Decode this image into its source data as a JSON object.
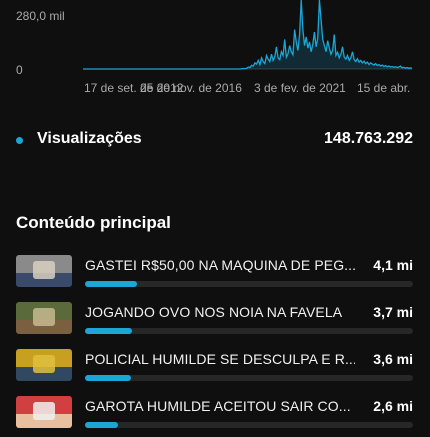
{
  "colors": {
    "accent": "#1ba6d6",
    "background": "#0f0f0f",
    "track": "#272727",
    "muted_text": "#aaaaaa"
  },
  "chart_data": {
    "type": "area",
    "title": "",
    "xlabel": "",
    "ylabel": "",
    "y_ticks": [
      "280,0 mil",
      "0"
    ],
    "x_ticks": [
      "17 de set. de 2012",
      "25 de nov. de 2016",
      "3 de fev. de 2021",
      "15 de abr."
    ],
    "ylim": [
      0,
      280000
    ],
    "series": [
      {
        "values": [
          0,
          0,
          0,
          0,
          0,
          0,
          0,
          0,
          0,
          0,
          0,
          0,
          0,
          0,
          0,
          0,
          0,
          0,
          0,
          0,
          0,
          0,
          0,
          0,
          0,
          0,
          0,
          0,
          0,
          0,
          0,
          0,
          0,
          0,
          0,
          0,
          0,
          0,
          0,
          0,
          0,
          0,
          0,
          0,
          0,
          0,
          0,
          0,
          0,
          0,
          0,
          0,
          0,
          0,
          0,
          0,
          0,
          0,
          0,
          0,
          0,
          0,
          0,
          0,
          0,
          0,
          0,
          0,
          0,
          0,
          0,
          0,
          0,
          0,
          0,
          0,
          0,
          0,
          0,
          0,
          0,
          0,
          0,
          0,
          0,
          0,
          0,
          0,
          0,
          0,
          0,
          0,
          0,
          0,
          0,
          0,
          1000,
          2000,
          1500,
          3000,
          8000,
          6000,
          15000,
          12000,
          25000,
          20000,
          35000,
          18000,
          45000,
          30000,
          22000,
          55000,
          40000,
          30000,
          60000,
          35000,
          50000,
          90000,
          45000,
          38000,
          70000,
          55000,
          120000,
          48000,
          62000,
          95000,
          70000,
          58000,
          160000,
          110000,
          75000,
          140000,
          280000,
          160000,
          95000,
          130000,
          85000,
          110000,
          70000,
          100000,
          150000,
          90000,
          125000,
          280000,
          200000,
          120000,
          95000,
          70000,
          115000,
          85000,
          60000,
          75000,
          140000,
          55000,
          68000,
          45000,
          60000,
          90000,
          48000,
          40000,
          55000,
          35000,
          45000,
          70000,
          38000,
          30000,
          42000,
          28000,
          35000,
          25000,
          32000,
          22000,
          28000,
          18000,
          25000,
          20000,
          16000,
          22000,
          14000,
          18000,
          12000,
          16000,
          10000,
          14000,
          9000,
          12000,
          8000,
          10000,
          7000,
          9000,
          6000,
          8000,
          12000,
          5000,
          7000,
          4000,
          6000,
          3000,
          5000,
          2000
        ]
      }
    ]
  },
  "metric": {
    "label": "Visualizações",
    "value": "148.763.292"
  },
  "section": {
    "title": "Conteúdo principal"
  },
  "videos": [
    {
      "title": "GASTEI R$50,00 NA MAQUINA DE PEG...",
      "views": "4,1 mi",
      "ratio": 0.158,
      "thumb": [
        "#8a8a8a",
        "#3a4a6a",
        "#d8d0c0"
      ]
    },
    {
      "title": "JOGANDO OVO NOS NOIA NA FAVELA",
      "views": "3,7 mi",
      "ratio": 0.143,
      "thumb": [
        "#5a6a3a",
        "#7a6040",
        "#c8b890"
      ]
    },
    {
      "title": "POLICIAL HUMILDE SE DESCULPA E R...",
      "views": "3,6 mi",
      "ratio": 0.139,
      "thumb": [
        "#c8a020",
        "#304860",
        "#e0c040"
      ]
    },
    {
      "title": "GAROTA HUMILDE ACEITOU SAIR CO...",
      "views": "2,6 mi",
      "ratio": 0.1,
      "thumb": [
        "#d04040",
        "#e8c0a0",
        "#f0f0f0"
      ]
    }
  ]
}
